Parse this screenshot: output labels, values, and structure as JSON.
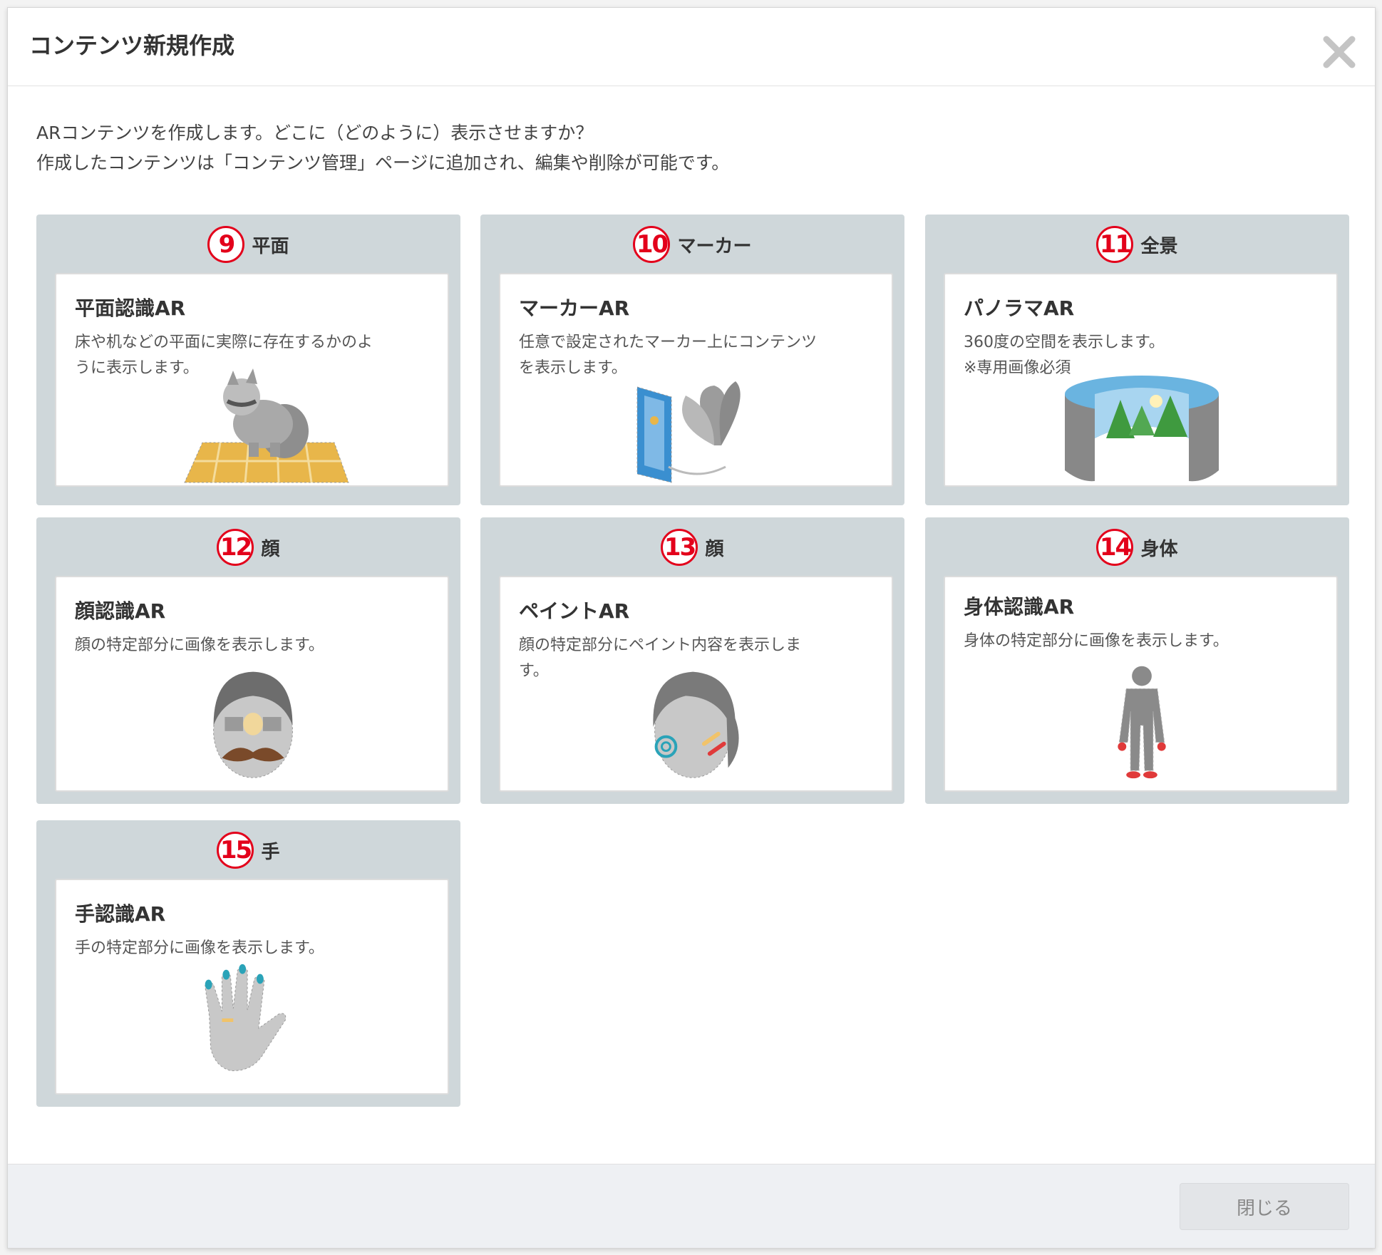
{
  "dialog": {
    "title": "コンテンツ新規作成",
    "intro_line1": "ARコンテンツを作成します。どこに（どのように）表示させますか？",
    "intro_line2": "作成したコンテンツは「コンテンツ管理」ページに追加され、編集や削除が可能です。",
    "close_label": "閉じる"
  },
  "cards": [
    {
      "number": "9",
      "category": "平面",
      "title": "平面認識AR",
      "desc_line1": "床や机などの平面に実際に存在するかのよ",
      "desc_line2": "うに表示します。",
      "icon": "raccoon-on-floor-icon"
    },
    {
      "number": "10",
      "category": "マーカー",
      "title": "マーカーAR",
      "desc_line1": "任意で設定されたマーカー上にコンテンツ",
      "desc_line2": "を表示します。",
      "icon": "marker-butterfly-icon"
    },
    {
      "number": "11",
      "category": "全景",
      "title": "パノラマAR",
      "desc_line1": "360度の空間を表示します。",
      "desc_line2": "※専用画像必須",
      "icon": "panorama-icon"
    },
    {
      "number": "12",
      "category": "顔",
      "title": "顔認識AR",
      "desc_line1": "顔の特定部分に画像を表示します。",
      "desc_line2": "",
      "icon": "face-mustache-icon"
    },
    {
      "number": "13",
      "category": "顔",
      "title": "ペイントAR",
      "desc_line1": "顔の特定部分にペイント内容を表示しま",
      "desc_line2": "す。",
      "icon": "face-paint-icon"
    },
    {
      "number": "14",
      "category": "身体",
      "title": "身体認識AR",
      "desc_line1": "身体の特定部分に画像を表示します。",
      "desc_line2": "",
      "icon": "body-icon"
    },
    {
      "number": "15",
      "category": "手",
      "title": "手認識AR",
      "desc_line1": "手の特定部分に画像を表示します。",
      "desc_line2": "",
      "icon": "hand-icon"
    }
  ],
  "colors": {
    "badge_red": "#e3001b",
    "card_bg": "#cfd7da",
    "floor_yellow": "#e8b64a",
    "nail_teal": "#2aa3b8"
  }
}
